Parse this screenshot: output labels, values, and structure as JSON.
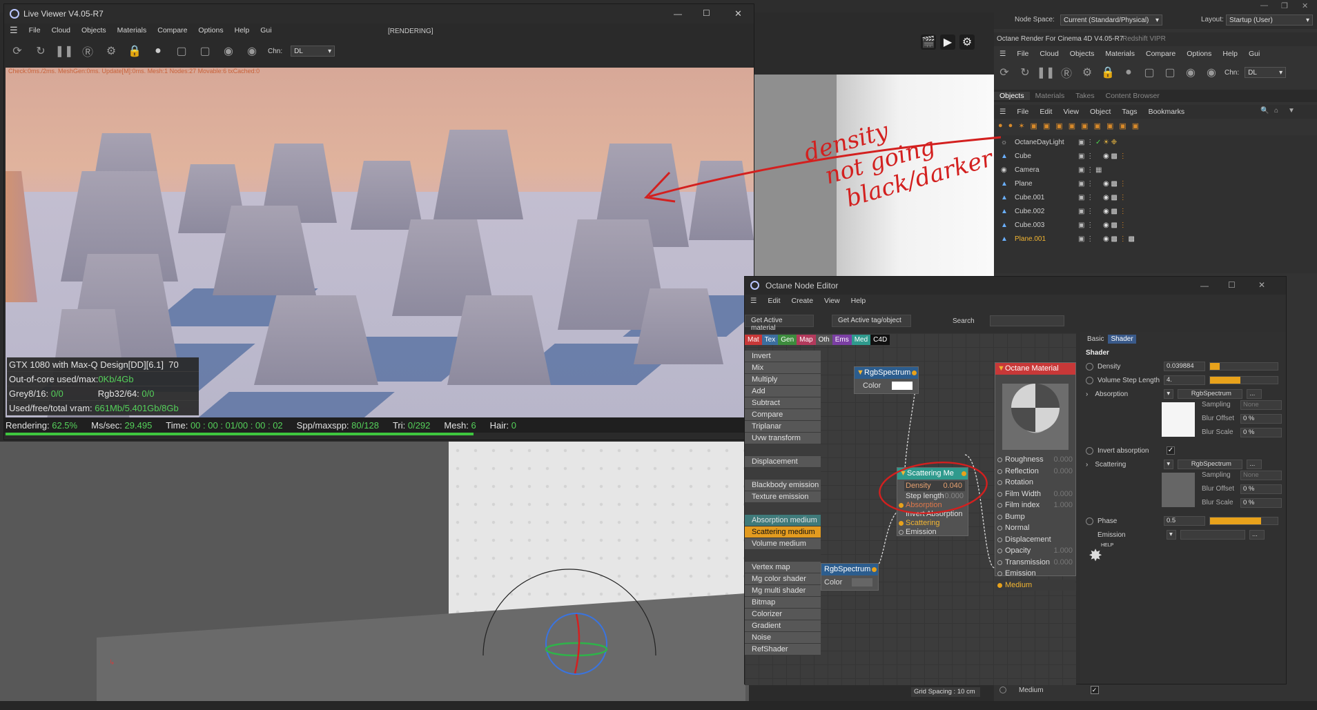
{
  "live_viewer": {
    "title": "Live Viewer V4.05-R7",
    "menu": [
      "File",
      "Cloud",
      "Objects",
      "Materials",
      "Compare",
      "Options",
      "Help",
      "Gui"
    ],
    "render_state": "[RENDERING]",
    "channel_label": "Chn:",
    "channel_value": "DL",
    "debug_line": "Check:0ms./2ms. MeshGen:0ms. Update[M]:0ms. Mesh:1 Nodes:27 Movable:6 txCached:0",
    "stats": {
      "gpu": "GTX 1080 with Max-Q Design[DD][6.1]",
      "gpu_temp": "70",
      "outofcore_label": "Out-of-core used/max:",
      "outofcore_value": "0Kb/4Gb",
      "grey_label": "Grey8/16:",
      "grey_value": "0/0",
      "rgb_label": "Rgb32/64:",
      "rgb_value": "0/0",
      "vram_label": "Used/free/total vram:",
      "vram_value": "661Mb/5.401Gb/8Gb"
    },
    "status": {
      "rendering_label": "Rendering:",
      "rendering_value": "62.5%",
      "ms_label": "Ms/sec:",
      "ms_value": "29.495",
      "time_label": "Time:",
      "time_value": "00 : 00 : 01/00 : 00 : 02",
      "spp_label": "Spp/maxspp:",
      "spp_value": "80/128",
      "tri_label": "Tri:",
      "tri_value": "0/292",
      "mesh_label": "Mesh:",
      "mesh_value": "6",
      "hair_label": "Hair:",
      "hair_value": "0"
    },
    "progress": 0.625
  },
  "annotation": {
    "line1": "density",
    "line2": "not going",
    "line3": "black/darker",
    "color": "#d3201f"
  },
  "c4d_top": {
    "node_space_label": "Node Space:",
    "node_space_value": "Current (Standard/Physical)",
    "layout_label": "Layout:",
    "layout_value": "Startup (User)"
  },
  "octane_render": {
    "title": "Octane Render For Cinema 4D V4.05-R7",
    "tab2": "Redshift VIPR",
    "menu": [
      "File",
      "Cloud",
      "Objects",
      "Materials",
      "Compare",
      "Options",
      "Help",
      "Gui"
    ],
    "channel_label": "Chn:",
    "channel_value": "DL"
  },
  "objects_panel": {
    "tabs": [
      "Objects",
      "Materials",
      "Takes",
      "Content Browser"
    ],
    "menu": [
      "File",
      "Edit",
      "View",
      "Object",
      "Tags",
      "Bookmarks"
    ],
    "items": [
      {
        "name": "OctaneDayLight",
        "type": "light"
      },
      {
        "name": "Cube",
        "type": "cube"
      },
      {
        "name": "Camera",
        "type": "camera"
      },
      {
        "name": "Plane",
        "type": "plane"
      },
      {
        "name": "Cube.001",
        "type": "cube"
      },
      {
        "name": "Cube.002",
        "type": "cube"
      },
      {
        "name": "Cube.003",
        "type": "cube"
      },
      {
        "name": "Plane.001",
        "type": "plane",
        "selected": true
      }
    ]
  },
  "node_editor": {
    "title": "Octane Node Editor",
    "menu": [
      "Edit",
      "Create",
      "View",
      "Help"
    ],
    "get_active_material": "Get Active material",
    "get_active_tag": "Get Active tag/object",
    "search_label": "Search",
    "categories": [
      "Mat",
      "Tex",
      "Gen",
      "Map",
      "Oth",
      "Ems",
      "Med",
      "C4D"
    ],
    "node_list": [
      {
        "label": "Invert",
        "color": "#575757"
      },
      {
        "label": "Mix",
        "color": "#575757"
      },
      {
        "label": "Multiply",
        "color": "#575757"
      },
      {
        "label": "Add",
        "color": "#575757"
      },
      {
        "label": "Subtract",
        "color": "#575757"
      },
      {
        "label": "Compare",
        "color": "#575757"
      },
      {
        "label": "Triplanar",
        "color": "#575757"
      },
      {
        "label": "Uvw transform",
        "color": "#575757"
      },
      {
        "label": "",
        "color": "#3c3c3c"
      },
      {
        "label": "Displacement",
        "color": "#575757"
      },
      {
        "label": "",
        "color": "#3c3c3c"
      },
      {
        "label": "Blackbody emission",
        "color": "#575757"
      },
      {
        "label": "Texture emission",
        "color": "#575757"
      },
      {
        "label": "",
        "color": "#3c3c3c"
      },
      {
        "label": "Absorption medium",
        "color": "#3f7a7a"
      },
      {
        "label": "Scattering medium",
        "color": "#e39b1f"
      },
      {
        "label": "Volume medium",
        "color": "#575757"
      },
      {
        "label": "",
        "color": "#3c3c3c"
      },
      {
        "label": "Vertex map",
        "color": "#575757"
      },
      {
        "label": "Mg color shader",
        "color": "#575757"
      },
      {
        "label": "Mg multi shader",
        "color": "#575757"
      },
      {
        "label": "Bitmap",
        "color": "#575757"
      },
      {
        "label": "Colorizer",
        "color": "#575757"
      },
      {
        "label": "Gradient",
        "color": "#575757"
      },
      {
        "label": "Noise",
        "color": "#575757"
      },
      {
        "label": "RefShader",
        "color": "#575757"
      }
    ],
    "rgb1": {
      "title": "RgbSpectrum",
      "color_label": "Color"
    },
    "rgb2": {
      "title": "RgbSpectrum",
      "color_label": "Color"
    },
    "scattering": {
      "title": "Scattering Me",
      "density_label": "Density",
      "density_value": "0.040",
      "step_label": "Step length",
      "step_value": "0.000",
      "ports": [
        "Absorption",
        "Invert Absorption",
        "Scattering",
        "Emission"
      ]
    },
    "material": {
      "title": "Octane Material",
      "ports": [
        {
          "label": "Roughness",
          "value": "0.000"
        },
        {
          "label": "Reflection",
          "value": "0.000"
        },
        {
          "label": "Rotation",
          "value": ""
        },
        {
          "label": "Film Width",
          "value": "0.000"
        },
        {
          "label": "Film index",
          "value": "1.000"
        },
        {
          "label": "Bump",
          "value": ""
        },
        {
          "label": "Normal",
          "value": ""
        },
        {
          "label": "Displacement",
          "value": ""
        },
        {
          "label": "Opacity",
          "value": "1.000"
        },
        {
          "label": "Transmission",
          "value": "0.000"
        },
        {
          "label": "Emission",
          "value": ""
        },
        {
          "label": "Medium",
          "value": ""
        }
      ]
    },
    "props": {
      "tab_basic": "Basic",
      "tab_shader": "Shader",
      "section": "Shader",
      "density_label": "Density",
      "density_value": "0.039884",
      "density_fill": 0.14,
      "vsl_label": "Volume Step Length",
      "vsl_value": "4.",
      "vsl_fill": 0.45,
      "absorption_label": "Absorption",
      "absorption_shader": "RgbSpectrum",
      "sampling_label": "Sampling",
      "sampling_value": "None",
      "blur_offset_label": "Blur Offset",
      "blur_offset_value": "0 %",
      "blur_scale_label": "Blur Scale",
      "blur_scale_value": "0 %",
      "invert_label": "Invert absorption",
      "scattering_label": "Scattering",
      "scattering_shader": "RgbSpectrum",
      "phase_label": "Phase",
      "phase_value": "0.5",
      "phase_fill": 0.75,
      "emission_label": "Emission",
      "help_label": "HELP"
    }
  },
  "bottom": {
    "grid_spacing": "Grid Spacing : 10 cm",
    "medium_label": "Medium"
  }
}
